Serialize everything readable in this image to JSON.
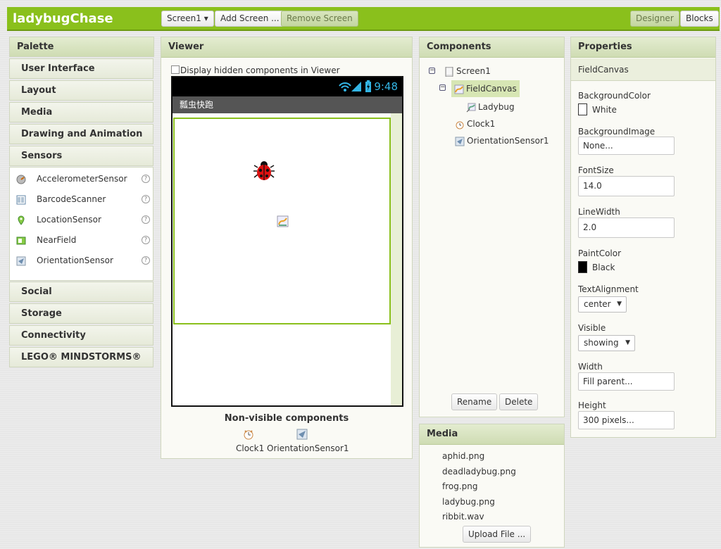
{
  "app": {
    "title": "ladybugChase"
  },
  "toolbar": {
    "screen_select": "Screen1 ▾",
    "add_screen": "Add Screen ...",
    "remove_screen": "Remove Screen",
    "designer": "Designer",
    "blocks": "Blocks"
  },
  "palette": {
    "title": "Palette",
    "categories_top": [
      "User Interface",
      "Layout",
      "Media",
      "Drawing and Animation",
      "Sensors"
    ],
    "sensors": [
      {
        "label": "AccelerometerSensor",
        "icon": "accelerometer-icon"
      },
      {
        "label": "BarcodeScanner",
        "icon": "barcode-icon"
      },
      {
        "label": "LocationSensor",
        "icon": "location-pin-icon"
      },
      {
        "label": "NearField",
        "icon": "nfc-icon"
      },
      {
        "label": "OrientationSensor",
        "icon": "orientation-icon"
      }
    ],
    "help": "?",
    "categories_bottom": [
      "Social",
      "Storage",
      "Connectivity",
      "LEGO® MINDSTORMS®"
    ]
  },
  "viewer": {
    "title": "Viewer",
    "hidden_checkbox_label": "Display hidden components in Viewer",
    "status_time": "9:48",
    "app_title": "瓢虫快跑",
    "nonvisible_title": "Non-visible components",
    "nonvisible": [
      "Clock1",
      "OrientationSensor1"
    ]
  },
  "components": {
    "title": "Components",
    "tree": [
      "Screen1",
      "FieldCanvas",
      "Ladybug",
      "Clock1",
      "OrientationSensor1"
    ],
    "rename": "Rename",
    "delete": "Delete",
    "toggle": "⊟"
  },
  "media": {
    "title": "Media",
    "files": [
      "aphid.png",
      "deadladybug.png",
      "frog.png",
      "ladybug.png",
      "ribbit.wav"
    ],
    "upload": "Upload File ..."
  },
  "properties": {
    "title": "Properties",
    "component": "FieldCanvas",
    "background_color_label": "BackgroundColor",
    "background_color": "White",
    "background_image_label": "BackgroundImage",
    "background_image": "None...",
    "font_size_label": "FontSize",
    "font_size": "14.0",
    "line_width_label": "LineWidth",
    "line_width": "2.0",
    "paint_color_label": "PaintColor",
    "paint_color": "Black",
    "text_alignment_label": "TextAlignment",
    "text_alignment": "center",
    "visible_label": "Visible",
    "visible": "showing",
    "width_label": "Width",
    "width": "Fill parent...",
    "height_label": "Height",
    "height": "300 pixels..."
  },
  "colors": {
    "accent": "#8ac01c",
    "selected": "#d7e6b4",
    "clock": "#33b5e5"
  }
}
